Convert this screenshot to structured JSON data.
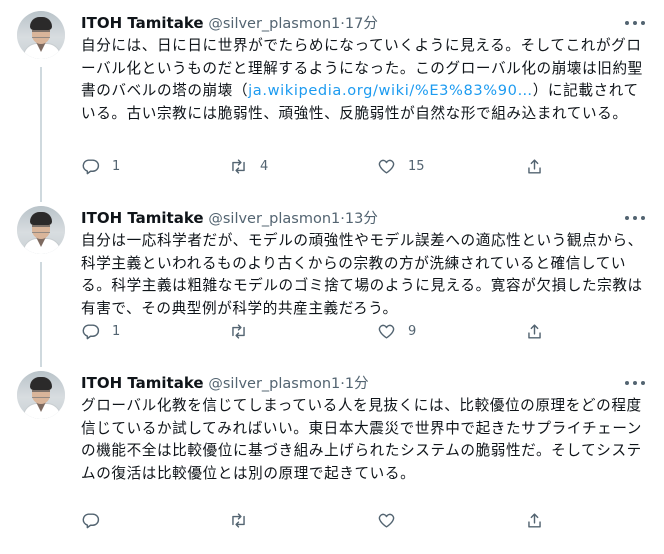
{
  "author": {
    "name": "ITOH Tamitake",
    "handle": "@silver_plasmon1",
    "separator": "·"
  },
  "tweets": [
    {
      "time": "17分",
      "text_before": "自分には、日に日に世界がでたらめになっていくように見える。そしてこれがグローバル化というものだと理解するようになった。このグローバル化の崩壊は旧約聖書のバベルの塔の崩壊（",
      "link": "ja.wikipedia.org/wiki/%E3%83%90…",
      "text_after": "）に記載されている。古い宗教には脆弱性、頑強性、反脆弱性が自然な形で組み込まれている。",
      "replies": "1",
      "retweets": "4",
      "likes": "15"
    },
    {
      "time": "13分",
      "text_before": "自分は一応科学者だが、モデルの頑強性やモデル誤差への適応性という観点から、科学主義といわれるものより古くからの宗教の方が洗練されていると確信している。科学主義は粗雑なモデルのゴミ捨て場のように見える。寛容が欠損した宗教は有害で、その典型例が科学的共産主義だろう。",
      "link": "",
      "text_after": "",
      "replies": "1",
      "retweets": "",
      "likes": "9"
    },
    {
      "time": "1分",
      "text_before": "グローバル化教を信じてしまっている人を見抜くには、比較優位の原理をどの程度信じているか試してみればいい。東日本大震災で世界中で起きたサプライチェーンの機能不全は比較優位に基づき組み上げられたシステムの脆弱性だ。そしてシステムの復活は比較優位とは別の原理で起きている。",
      "link": "",
      "text_after": "",
      "replies": "",
      "retweets": "",
      "likes": ""
    }
  ],
  "icons": {
    "reply": "reply-icon",
    "retweet": "retweet-icon",
    "like": "heart-icon",
    "share": "share-icon",
    "more": "more-icon"
  },
  "colors": {
    "text": "#0f1419",
    "secondary": "#536471",
    "link": "#1d9bf0",
    "thread_line": "#cfd9de"
  }
}
